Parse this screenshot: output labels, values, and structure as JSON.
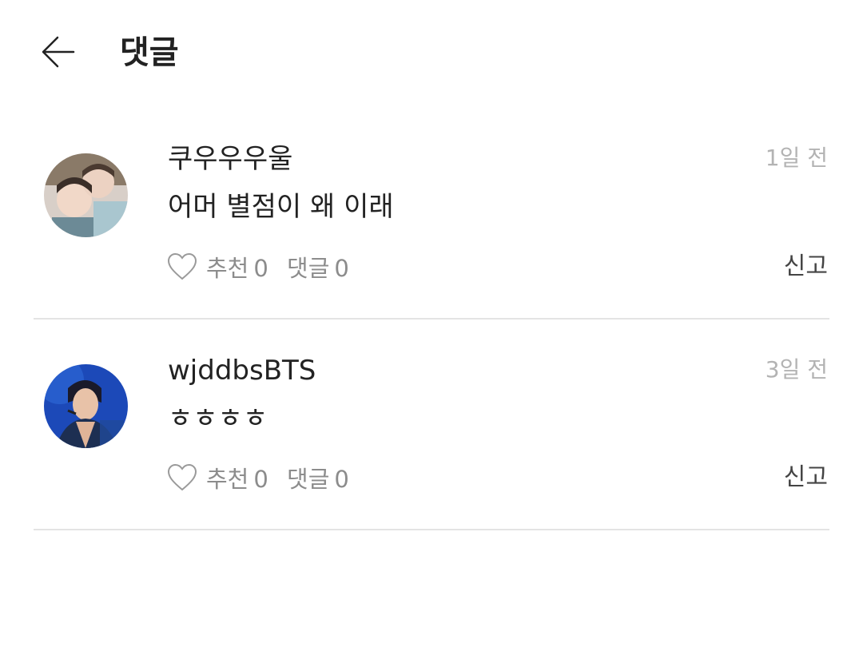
{
  "header": {
    "title": "댓글",
    "back_icon": "arrow-left-icon"
  },
  "comments": [
    {
      "username": "쿠우우우울",
      "time": "1일 전",
      "text": "어머 별점이 왜 이래",
      "like_label": "추천",
      "like_count": "0",
      "reply_label": "댓글",
      "reply_count": "0",
      "report_label": "신고"
    },
    {
      "username": "wjddbsBTS",
      "time": "3일 전",
      "text": "ㅎㅎㅎㅎ",
      "like_label": "추천",
      "like_count": "0",
      "reply_label": "댓글",
      "reply_count": "0",
      "report_label": "신고"
    }
  ],
  "colors": {
    "text": "#222222",
    "muted": "#8c8c8c",
    "time": "#b3b3b3",
    "divider": "#e4e4e4"
  }
}
